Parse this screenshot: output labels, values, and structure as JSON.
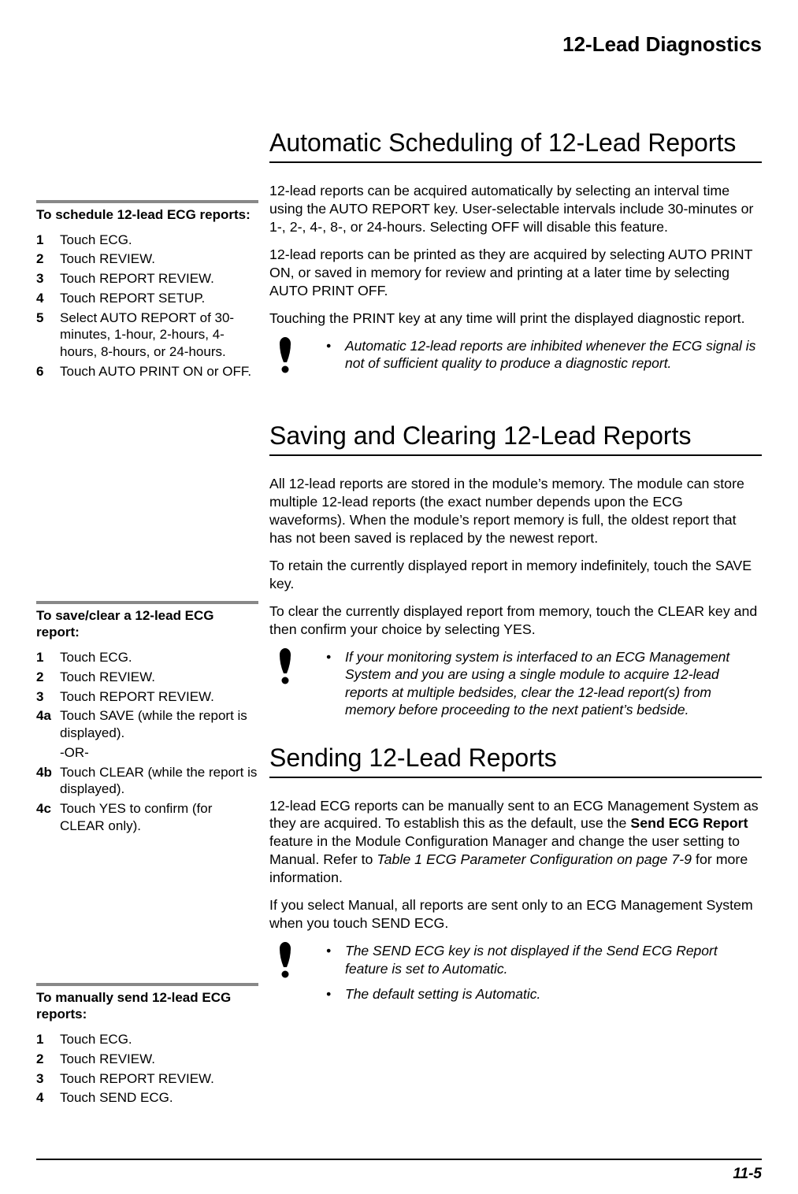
{
  "header": {
    "title": "12-Lead Diagnostics"
  },
  "sidebar": {
    "block1": {
      "title": "To schedule 12-lead ECG reports:",
      "items": [
        {
          "n": "1",
          "t": "Touch ECG."
        },
        {
          "n": "2",
          "t": "Touch REVIEW."
        },
        {
          "n": "3",
          "t": "Touch REPORT REVIEW."
        },
        {
          "n": "4",
          "t": "Touch REPORT SETUP."
        },
        {
          "n": "5",
          "t": "Select AUTO REPORT of 30-minutes, 1-hour, 2-hours, 4-hours, 8-hours, or 24-hours."
        },
        {
          "n": "6",
          "t": "Touch AUTO PRINT ON or OFF."
        }
      ]
    },
    "block2": {
      "title": "To save/clear a 12-lead ECG report:",
      "items": [
        {
          "n": "1",
          "t": "Touch ECG."
        },
        {
          "n": "2",
          "t": "Touch REVIEW."
        },
        {
          "n": "3",
          "t": "Touch REPORT REVIEW."
        },
        {
          "n": "4a",
          "t": "Touch SAVE (while the report is displayed)."
        },
        {
          "n": "",
          "t": "-OR-"
        },
        {
          "n": "4b",
          "t": "Touch CLEAR (while the report is displayed)."
        },
        {
          "n": "4c",
          "t": "Touch YES to confirm (for CLEAR only)."
        }
      ]
    },
    "block3": {
      "title": "To manually send 12-lead ECG reports:",
      "items": [
        {
          "n": "1",
          "t": "Touch ECG."
        },
        {
          "n": "2",
          "t": "Touch REVIEW."
        },
        {
          "n": "3",
          "t": "Touch REPORT REVIEW."
        },
        {
          "n": "4",
          "t": "Touch SEND ECG."
        }
      ]
    }
  },
  "main": {
    "s1": {
      "title": "Automatic Scheduling of 12-Lead Reports",
      "p1": "12-lead reports can be acquired automatically by selecting an interval time using the AUTO REPORT key. User-selectable intervals include 30-minutes or 1-, 2-, 4-, 8-, or 24-hours. Selecting OFF will disable this feature.",
      "p2": "12-lead reports can be printed as they are acquired by selecting AUTO PRINT ON, or saved in memory for review and printing at a later time by selecting AUTO PRINT OFF.",
      "p3": "Touching the PRINT key at any time will print the displayed diagnostic report.",
      "note1": "Automatic 12-lead reports are inhibited whenever the ECG signal is not of sufficient quality to produce a diagnostic report."
    },
    "s2": {
      "title": "Saving and Clearing 12-Lead Reports",
      "p1": "All 12-lead reports are stored in the module’s memory. The module can store multiple 12-lead reports (the exact number depends upon the ECG waveforms). When the module’s report memory is full, the oldest report that has not been saved is replaced by the newest report.",
      "p2": "To retain the currently displayed report in memory indefinitely, touch the SAVE key.",
      "p3": "To clear the currently displayed report from memory, touch the CLEAR key and then confirm your choice by selecting YES.",
      "note1": "If your monitoring system is interfaced to an ECG Management System and you are using a single module to acquire 12-lead reports at multiple bedsides, clear the 12-lead report(s) from memory before proceeding to the next patient’s bedside."
    },
    "s3": {
      "title": "Sending 12-Lead Reports",
      "p1a": "12-lead ECG reports can be manually sent to an ECG Management System as they are acquired. To establish this as the default, use the ",
      "p1b": "Send ECG Report",
      "p1c": " feature in the Module Configuration Manager and change the user setting to Manual. Refer to ",
      "p1d": "Table 1 ECG Parameter Configuration on page 7-9",
      "p1e": " for more information.",
      "p2": "If you select Manual, all reports are sent only to an ECG Management System when you touch SEND ECG.",
      "note1": "The SEND ECG key is not displayed if the Send ECG Report feature is set to Automatic.",
      "note2": "The default setting is Automatic."
    }
  },
  "footer": {
    "pagenum": "11-5"
  }
}
